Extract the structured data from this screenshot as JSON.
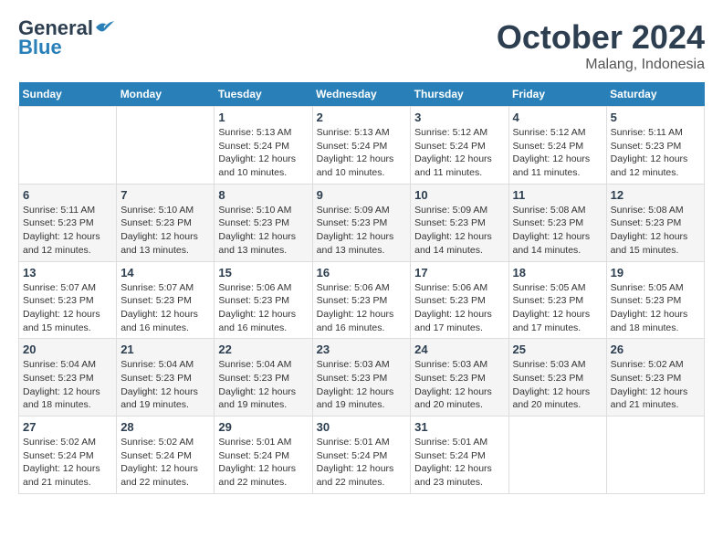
{
  "header": {
    "logo_general": "General",
    "logo_blue": "Blue",
    "month": "October 2024",
    "location": "Malang, Indonesia"
  },
  "days_of_week": [
    "Sunday",
    "Monday",
    "Tuesday",
    "Wednesday",
    "Thursday",
    "Friday",
    "Saturday"
  ],
  "weeks": [
    [
      {
        "day": "",
        "sunrise": "",
        "sunset": "",
        "daylight": ""
      },
      {
        "day": "",
        "sunrise": "",
        "sunset": "",
        "daylight": ""
      },
      {
        "day": "1",
        "sunrise": "Sunrise: 5:13 AM",
        "sunset": "Sunset: 5:24 PM",
        "daylight": "Daylight: 12 hours and 10 minutes."
      },
      {
        "day": "2",
        "sunrise": "Sunrise: 5:13 AM",
        "sunset": "Sunset: 5:24 PM",
        "daylight": "Daylight: 12 hours and 10 minutes."
      },
      {
        "day": "3",
        "sunrise": "Sunrise: 5:12 AM",
        "sunset": "Sunset: 5:24 PM",
        "daylight": "Daylight: 12 hours and 11 minutes."
      },
      {
        "day": "4",
        "sunrise": "Sunrise: 5:12 AM",
        "sunset": "Sunset: 5:24 PM",
        "daylight": "Daylight: 12 hours and 11 minutes."
      },
      {
        "day": "5",
        "sunrise": "Sunrise: 5:11 AM",
        "sunset": "Sunset: 5:23 PM",
        "daylight": "Daylight: 12 hours and 12 minutes."
      }
    ],
    [
      {
        "day": "6",
        "sunrise": "Sunrise: 5:11 AM",
        "sunset": "Sunset: 5:23 PM",
        "daylight": "Daylight: 12 hours and 12 minutes."
      },
      {
        "day": "7",
        "sunrise": "Sunrise: 5:10 AM",
        "sunset": "Sunset: 5:23 PM",
        "daylight": "Daylight: 12 hours and 13 minutes."
      },
      {
        "day": "8",
        "sunrise": "Sunrise: 5:10 AM",
        "sunset": "Sunset: 5:23 PM",
        "daylight": "Daylight: 12 hours and 13 minutes."
      },
      {
        "day": "9",
        "sunrise": "Sunrise: 5:09 AM",
        "sunset": "Sunset: 5:23 PM",
        "daylight": "Daylight: 12 hours and 13 minutes."
      },
      {
        "day": "10",
        "sunrise": "Sunrise: 5:09 AM",
        "sunset": "Sunset: 5:23 PM",
        "daylight": "Daylight: 12 hours and 14 minutes."
      },
      {
        "day": "11",
        "sunrise": "Sunrise: 5:08 AM",
        "sunset": "Sunset: 5:23 PM",
        "daylight": "Daylight: 12 hours and 14 minutes."
      },
      {
        "day": "12",
        "sunrise": "Sunrise: 5:08 AM",
        "sunset": "Sunset: 5:23 PM",
        "daylight": "Daylight: 12 hours and 15 minutes."
      }
    ],
    [
      {
        "day": "13",
        "sunrise": "Sunrise: 5:07 AM",
        "sunset": "Sunset: 5:23 PM",
        "daylight": "Daylight: 12 hours and 15 minutes."
      },
      {
        "day": "14",
        "sunrise": "Sunrise: 5:07 AM",
        "sunset": "Sunset: 5:23 PM",
        "daylight": "Daylight: 12 hours and 16 minutes."
      },
      {
        "day": "15",
        "sunrise": "Sunrise: 5:06 AM",
        "sunset": "Sunset: 5:23 PM",
        "daylight": "Daylight: 12 hours and 16 minutes."
      },
      {
        "day": "16",
        "sunrise": "Sunrise: 5:06 AM",
        "sunset": "Sunset: 5:23 PM",
        "daylight": "Daylight: 12 hours and 16 minutes."
      },
      {
        "day": "17",
        "sunrise": "Sunrise: 5:06 AM",
        "sunset": "Sunset: 5:23 PM",
        "daylight": "Daylight: 12 hours and 17 minutes."
      },
      {
        "day": "18",
        "sunrise": "Sunrise: 5:05 AM",
        "sunset": "Sunset: 5:23 PM",
        "daylight": "Daylight: 12 hours and 17 minutes."
      },
      {
        "day": "19",
        "sunrise": "Sunrise: 5:05 AM",
        "sunset": "Sunset: 5:23 PM",
        "daylight": "Daylight: 12 hours and 18 minutes."
      }
    ],
    [
      {
        "day": "20",
        "sunrise": "Sunrise: 5:04 AM",
        "sunset": "Sunset: 5:23 PM",
        "daylight": "Daylight: 12 hours and 18 minutes."
      },
      {
        "day": "21",
        "sunrise": "Sunrise: 5:04 AM",
        "sunset": "Sunset: 5:23 PM",
        "daylight": "Daylight: 12 hours and 19 minutes."
      },
      {
        "day": "22",
        "sunrise": "Sunrise: 5:04 AM",
        "sunset": "Sunset: 5:23 PM",
        "daylight": "Daylight: 12 hours and 19 minutes."
      },
      {
        "day": "23",
        "sunrise": "Sunrise: 5:03 AM",
        "sunset": "Sunset: 5:23 PM",
        "daylight": "Daylight: 12 hours and 19 minutes."
      },
      {
        "day": "24",
        "sunrise": "Sunrise: 5:03 AM",
        "sunset": "Sunset: 5:23 PM",
        "daylight": "Daylight: 12 hours and 20 minutes."
      },
      {
        "day": "25",
        "sunrise": "Sunrise: 5:03 AM",
        "sunset": "Sunset: 5:23 PM",
        "daylight": "Daylight: 12 hours and 20 minutes."
      },
      {
        "day": "26",
        "sunrise": "Sunrise: 5:02 AM",
        "sunset": "Sunset: 5:23 PM",
        "daylight": "Daylight: 12 hours and 21 minutes."
      }
    ],
    [
      {
        "day": "27",
        "sunrise": "Sunrise: 5:02 AM",
        "sunset": "Sunset: 5:24 PM",
        "daylight": "Daylight: 12 hours and 21 minutes."
      },
      {
        "day": "28",
        "sunrise": "Sunrise: 5:02 AM",
        "sunset": "Sunset: 5:24 PM",
        "daylight": "Daylight: 12 hours and 22 minutes."
      },
      {
        "day": "29",
        "sunrise": "Sunrise: 5:01 AM",
        "sunset": "Sunset: 5:24 PM",
        "daylight": "Daylight: 12 hours and 22 minutes."
      },
      {
        "day": "30",
        "sunrise": "Sunrise: 5:01 AM",
        "sunset": "Sunset: 5:24 PM",
        "daylight": "Daylight: 12 hours and 22 minutes."
      },
      {
        "day": "31",
        "sunrise": "Sunrise: 5:01 AM",
        "sunset": "Sunset: 5:24 PM",
        "daylight": "Daylight: 12 hours and 23 minutes."
      },
      {
        "day": "",
        "sunrise": "",
        "sunset": "",
        "daylight": ""
      },
      {
        "day": "",
        "sunrise": "",
        "sunset": "",
        "daylight": ""
      }
    ]
  ]
}
